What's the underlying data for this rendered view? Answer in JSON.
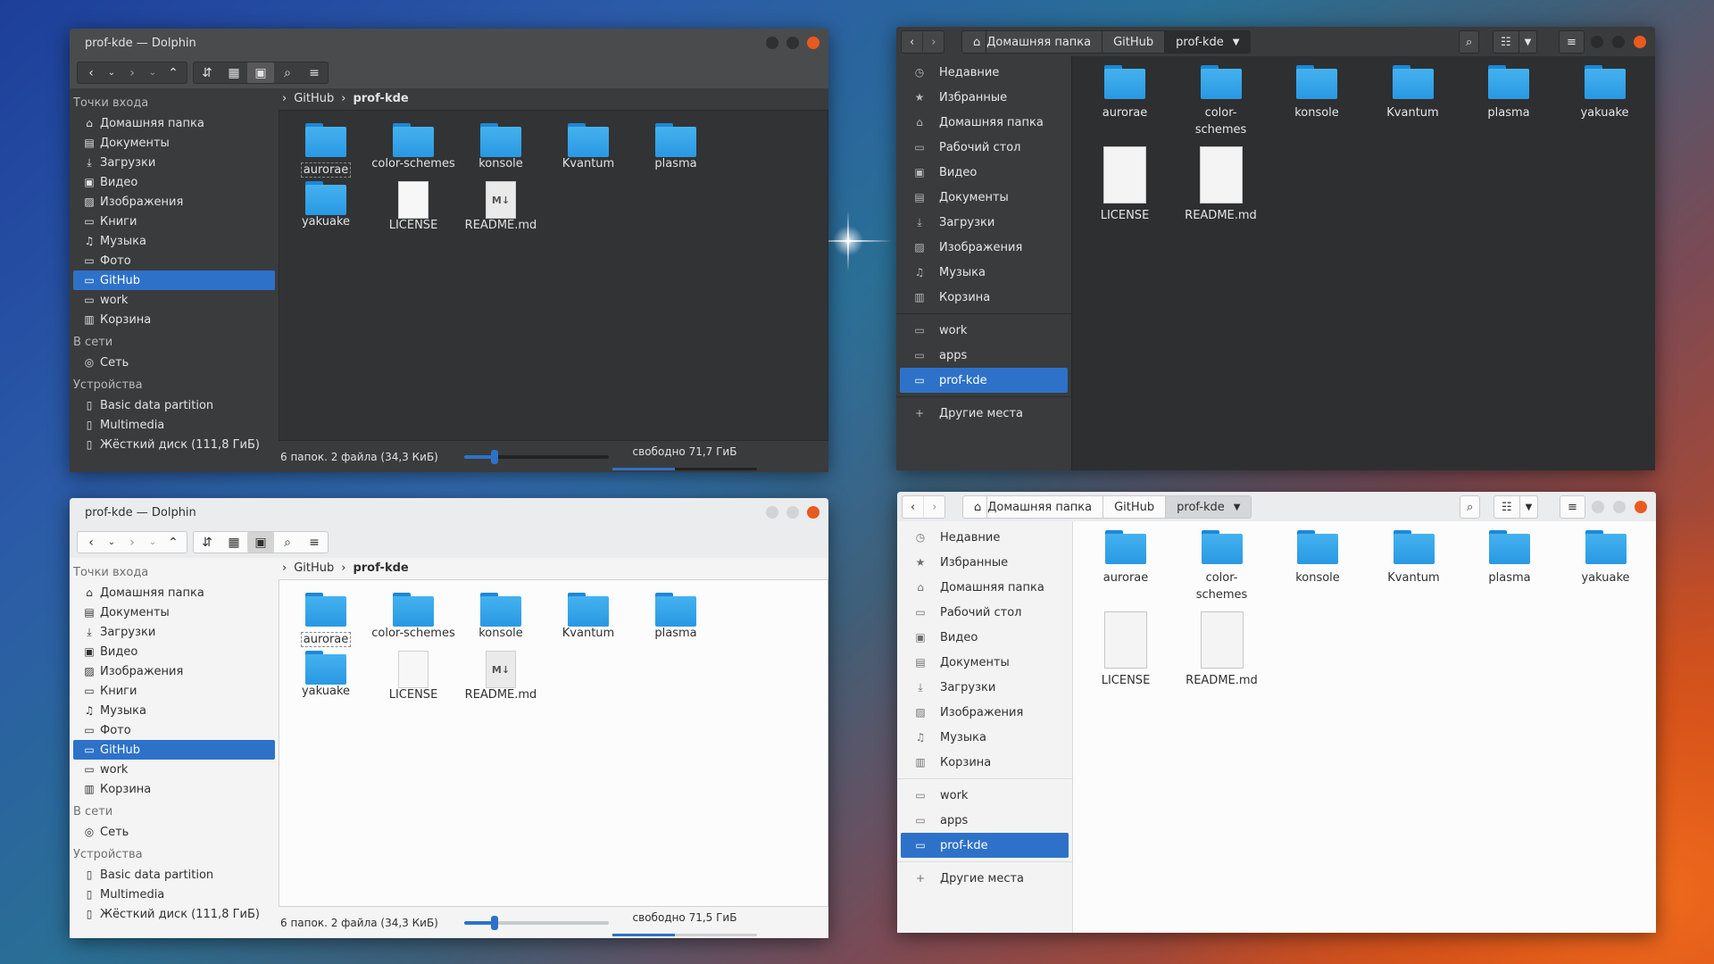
{
  "dolphin": {
    "title": "prof-kde — Dolphin",
    "places_header": "Точки входа",
    "places": [
      {
        "label": "Домашняя папка",
        "icon": "home-icon"
      },
      {
        "label": "Документы",
        "icon": "documents-icon"
      },
      {
        "label": "Загрузки",
        "icon": "downloads-icon"
      },
      {
        "label": "Видео",
        "icon": "video-icon"
      },
      {
        "label": "Изображения",
        "icon": "pictures-icon"
      },
      {
        "label": "Книги",
        "icon": "folder-icon"
      },
      {
        "label": "Музыка",
        "icon": "music-icon"
      },
      {
        "label": "Фото",
        "icon": "folder-icon"
      },
      {
        "label": "GitHub",
        "icon": "folder-icon"
      },
      {
        "label": "work",
        "icon": "folder-icon"
      },
      {
        "label": "Корзина",
        "icon": "trash-icon"
      }
    ],
    "network_header": "В сети",
    "network": [
      {
        "label": "Сеть",
        "icon": "network-icon"
      }
    ],
    "devices_header": "Устройства",
    "devices": [
      {
        "label": "Basic data partition",
        "icon": "drive-icon"
      },
      {
        "label": "Multimedia",
        "icon": "drive-icon"
      },
      {
        "label": "Жёсткий диск (111,8 ГиБ)",
        "icon": "drive-icon"
      }
    ],
    "crumb_parent": "GitHub",
    "crumb_current": "prof-kde",
    "items": [
      "aurorae",
      "color-schemes",
      "konsole",
      "Kvantum",
      "plasma",
      "yakuake",
      "LICENSE",
      "README.md"
    ],
    "status_text": "6 папок. 2 файла (34,3 КиБ)",
    "free_dark": "свободно 71,7 ГиБ",
    "free_light": "свободно 71,5 ГиБ",
    "zoom_fraction": 0.22
  },
  "nautilus": {
    "path": [
      "Домашняя папка",
      "GitHub",
      "prof-kde"
    ],
    "sidebar": [
      {
        "label": "Недавние",
        "icon": "clock-icon"
      },
      {
        "label": "Избранные",
        "icon": "star-icon"
      },
      {
        "label": "Домашняя папка",
        "icon": "home-icon"
      },
      {
        "label": "Рабочий стол",
        "icon": "desktop-icon"
      },
      {
        "label": "Видео",
        "icon": "video-icon"
      },
      {
        "label": "Документы",
        "icon": "documents-icon"
      },
      {
        "label": "Загрузки",
        "icon": "downloads-icon"
      },
      {
        "label": "Изображения",
        "icon": "pictures-icon"
      },
      {
        "label": "Музыка",
        "icon": "music-icon"
      },
      {
        "label": "Корзина",
        "icon": "trash-icon"
      }
    ],
    "bookmarks": [
      {
        "label": "work",
        "icon": "folder-icon"
      },
      {
        "label": "apps",
        "icon": "folder-icon"
      },
      {
        "label": "prof-kde",
        "icon": "folder-icon"
      }
    ],
    "other": {
      "label": "Другие места",
      "icon": "plus-icon"
    },
    "folders": [
      "aurorae",
      "color-\nschemes",
      "konsole",
      "Kvantum",
      "plasma",
      "yakuake"
    ],
    "files": [
      "LICENSE",
      "README.md"
    ]
  },
  "colors": {
    "accent": "#2d72c8",
    "folder": "#3aa6ea",
    "close": "#e85a20"
  }
}
